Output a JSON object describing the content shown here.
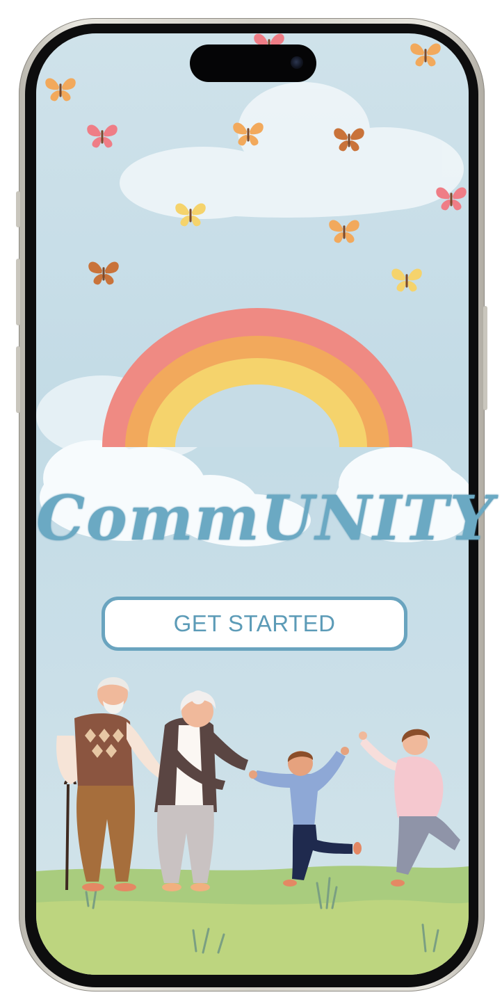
{
  "app": {
    "logo_text": "CommUNITY"
  },
  "cta": {
    "label": "GET STARTED"
  },
  "colors": {
    "sky": "#c6dce6",
    "rainbow_outer": "#ef8a83",
    "rainbow_middle": "#f2a95c",
    "rainbow_inner": "#f5d36c",
    "brand_blue": "#6ba9c3",
    "grass": "#a9cc7e"
  },
  "icons": {
    "decoration": "butterfly-icon",
    "hero": "rainbow-illustration",
    "footer": "family-illustration"
  }
}
